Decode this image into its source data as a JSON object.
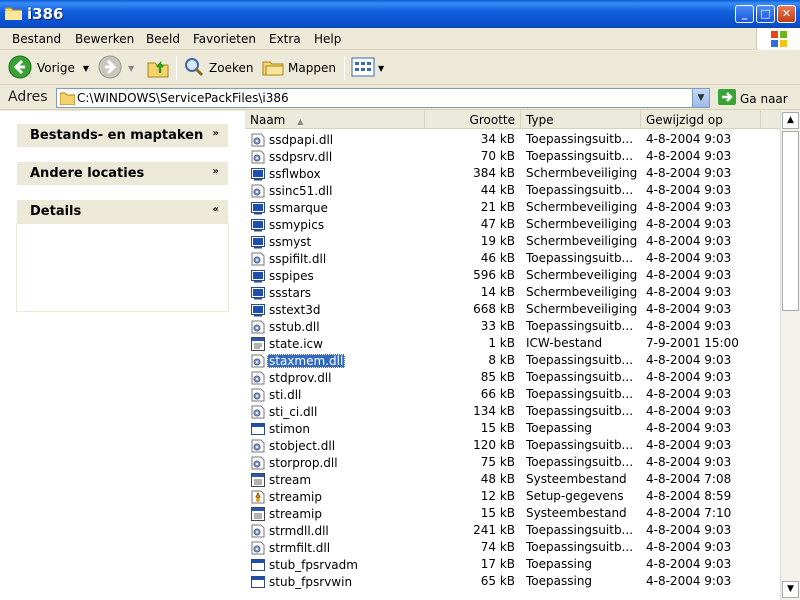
{
  "window": {
    "title": "i386"
  },
  "menu": [
    "Bestand",
    "Bewerken",
    "Beeld",
    "Favorieten",
    "Extra",
    "Help"
  ],
  "toolbar": {
    "back": "Vorige",
    "search": "Zoeken",
    "folders": "Mappen"
  },
  "address": {
    "label": "Adres",
    "path": "C:\\WINDOWS\\ServicePackFiles\\i386",
    "go": "Ga naar"
  },
  "taskpane": {
    "sections": [
      {
        "title": "Bestands- en maptaken",
        "chevron": "»"
      },
      {
        "title": "Andere locaties",
        "chevron": "»"
      },
      {
        "title": "Details",
        "chevron": "«"
      }
    ]
  },
  "columns": {
    "name": "Naam",
    "size": "Grootte",
    "type": "Type",
    "date": "Gewijzigd op"
  },
  "files": [
    {
      "name": "ssdpapi.dll",
      "size": "34 kB",
      "type": "Toepassingsuitb...",
      "date": "4-8-2004 9:03",
      "icon": "dll-icon"
    },
    {
      "name": "ssdpsrv.dll",
      "size": "70 kB",
      "type": "Toepassingsuitb...",
      "date": "4-8-2004 9:03",
      "icon": "dll-icon"
    },
    {
      "name": "ssflwbox",
      "size": "384 kB",
      "type": "Schermbeveiliging",
      "date": "4-8-2004 9:03",
      "icon": "screensaver-icon"
    },
    {
      "name": "ssinc51.dll",
      "size": "44 kB",
      "type": "Toepassingsuitb...",
      "date": "4-8-2004 9:03",
      "icon": "dll-icon"
    },
    {
      "name": "ssmarque",
      "size": "21 kB",
      "type": "Schermbeveiliging",
      "date": "4-8-2004 9:03",
      "icon": "screensaver-icon"
    },
    {
      "name": "ssmypics",
      "size": "47 kB",
      "type": "Schermbeveiliging",
      "date": "4-8-2004 9:03",
      "icon": "screensaver-icon"
    },
    {
      "name": "ssmyst",
      "size": "19 kB",
      "type": "Schermbeveiliging",
      "date": "4-8-2004 9:03",
      "icon": "screensaver-icon"
    },
    {
      "name": "sspifilt.dll",
      "size": "46 kB",
      "type": "Toepassingsuitb...",
      "date": "4-8-2004 9:03",
      "icon": "dll-icon"
    },
    {
      "name": "sspipes",
      "size": "596 kB",
      "type": "Schermbeveiliging",
      "date": "4-8-2004 9:03",
      "icon": "screensaver-icon"
    },
    {
      "name": "ssstars",
      "size": "14 kB",
      "type": "Schermbeveiliging",
      "date": "4-8-2004 9:03",
      "icon": "screensaver-icon"
    },
    {
      "name": "sstext3d",
      "size": "668 kB",
      "type": "Schermbeveiliging",
      "date": "4-8-2004 9:03",
      "icon": "screensaver-icon"
    },
    {
      "name": "sstub.dll",
      "size": "33 kB",
      "type": "Toepassingsuitb...",
      "date": "4-8-2004 9:03",
      "icon": "dll-icon"
    },
    {
      "name": "state.icw",
      "size": "1 kB",
      "type": "ICW-bestand",
      "date": "7-9-2001 15:00",
      "icon": "icw-file-icon"
    },
    {
      "name": "staxmem.dll",
      "size": "8 kB",
      "type": "Toepassingsuitb...",
      "date": "4-8-2004 9:03",
      "icon": "dll-icon",
      "selected": true
    },
    {
      "name": "stdprov.dll",
      "size": "85 kB",
      "type": "Toepassingsuitb...",
      "date": "4-8-2004 9:03",
      "icon": "dll-icon"
    },
    {
      "name": "sti.dll",
      "size": "66 kB",
      "type": "Toepassingsuitb...",
      "date": "4-8-2004 9:03",
      "icon": "dll-icon"
    },
    {
      "name": "sti_ci.dll",
      "size": "134 kB",
      "type": "Toepassingsuitb...",
      "date": "4-8-2004 9:03",
      "icon": "dll-icon"
    },
    {
      "name": "stimon",
      "size": "15 kB",
      "type": "Toepassing",
      "date": "4-8-2004 9:03",
      "icon": "application-icon"
    },
    {
      "name": "stobject.dll",
      "size": "120 kB",
      "type": "Toepassingsuitb...",
      "date": "4-8-2004 9:03",
      "icon": "dll-icon"
    },
    {
      "name": "storprop.dll",
      "size": "75 kB",
      "type": "Toepassingsuitb...",
      "date": "4-8-2004 9:03",
      "icon": "dll-icon"
    },
    {
      "name": "stream",
      "size": "48 kB",
      "type": "Systeembestand",
      "date": "4-8-2004 7:08",
      "icon": "system-file-icon"
    },
    {
      "name": "streamip",
      "size": "12 kB",
      "type": "Setup-gegevens",
      "date": "4-8-2004 8:59",
      "icon": "setup-info-icon"
    },
    {
      "name": "streamip",
      "size": "15 kB",
      "type": "Systeembestand",
      "date": "4-8-2004 7:10",
      "icon": "system-file-icon"
    },
    {
      "name": "strmdll.dll",
      "size": "241 kB",
      "type": "Toepassingsuitb...",
      "date": "4-8-2004 9:03",
      "icon": "dll-icon"
    },
    {
      "name": "strmfilt.dll",
      "size": "74 kB",
      "type": "Toepassingsuitb...",
      "date": "4-8-2004 9:03",
      "icon": "dll-icon"
    },
    {
      "name": "stub_fpsrvadm",
      "size": "17 kB",
      "type": "Toepassing",
      "date": "4-8-2004 9:03",
      "icon": "application-icon"
    },
    {
      "name": "stub_fpsrvwin",
      "size": "65 kB",
      "type": "Toepassing",
      "date": "4-8-2004 9:03",
      "icon": "application-icon"
    }
  ]
}
